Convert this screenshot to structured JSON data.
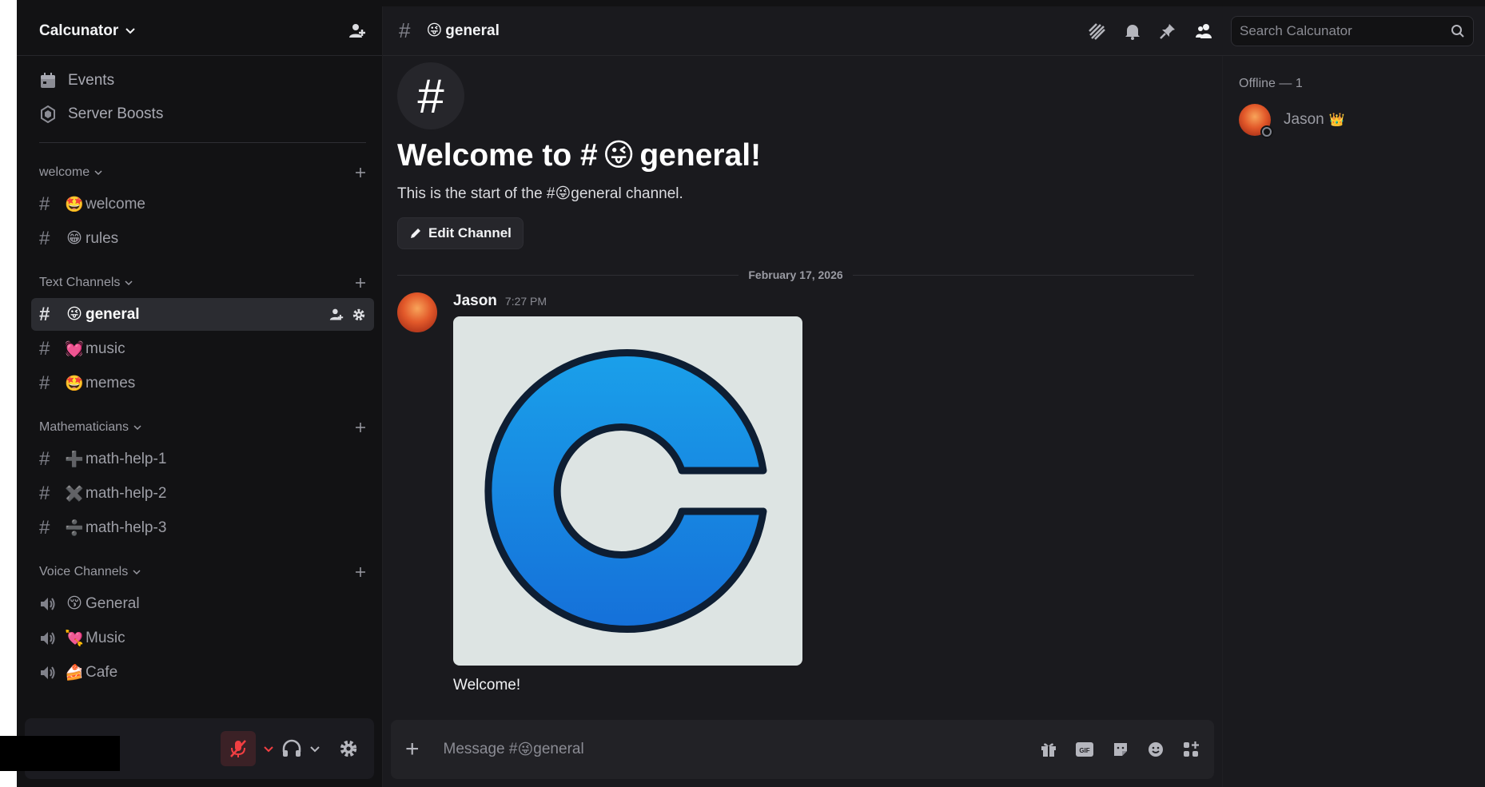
{
  "server": {
    "name": "Calcunator"
  },
  "nav": {
    "events": "Events",
    "boosts": "Server Boosts"
  },
  "categories": {
    "welcome": {
      "label": "welcome",
      "channels": [
        {
          "emoji": "🤩",
          "name": "welcome"
        },
        {
          "emoji": "😁",
          "name": "rules"
        }
      ]
    },
    "text": {
      "label": "Text Channels",
      "channels": [
        {
          "emoji": "😜",
          "name": "general"
        },
        {
          "emoji": "💓",
          "name": "music"
        },
        {
          "emoji": "🤩",
          "name": "memes"
        }
      ]
    },
    "math": {
      "label": "Mathematicians",
      "channels": [
        {
          "emoji": "➕",
          "name": "math-help-1"
        },
        {
          "emoji": "✖️",
          "name": "math-help-2"
        },
        {
          "emoji": "➗",
          "name": "math-help-3"
        }
      ]
    },
    "voice": {
      "label": "Voice Channels",
      "channels": [
        {
          "emoji": "😚",
          "name": "General"
        },
        {
          "emoji": "💘",
          "name": "Music"
        },
        {
          "emoji": "🍰",
          "name": "Cafe"
        }
      ]
    }
  },
  "header": {
    "channel_emoji": "😜",
    "channel_name": "general",
    "search_placeholder": "Search Calcunator"
  },
  "welcome": {
    "title_prefix": "Welcome to #",
    "emoji": "😜",
    "title_suffix": "general!",
    "sub_prefix": "This is the start of the #",
    "sub_suffix": "general channel.",
    "edit_button": "Edit Channel"
  },
  "date_divider": "February 17, 2026",
  "message": {
    "author": "Jason",
    "time": "7:27 PM",
    "text": "Welcome!"
  },
  "composer": {
    "prefix": "Message #",
    "emoji": "😜",
    "channel": "general"
  },
  "members": {
    "heading": "Offline — 1",
    "list": [
      {
        "name": "Jason",
        "badge": "👑"
      }
    ]
  },
  "colors": {
    "accent": "#5865f2",
    "background": "#1a1a1e",
    "sidebar": "#121214",
    "mute_red": "#f23f42",
    "math_purple": "#8a5cf6"
  }
}
